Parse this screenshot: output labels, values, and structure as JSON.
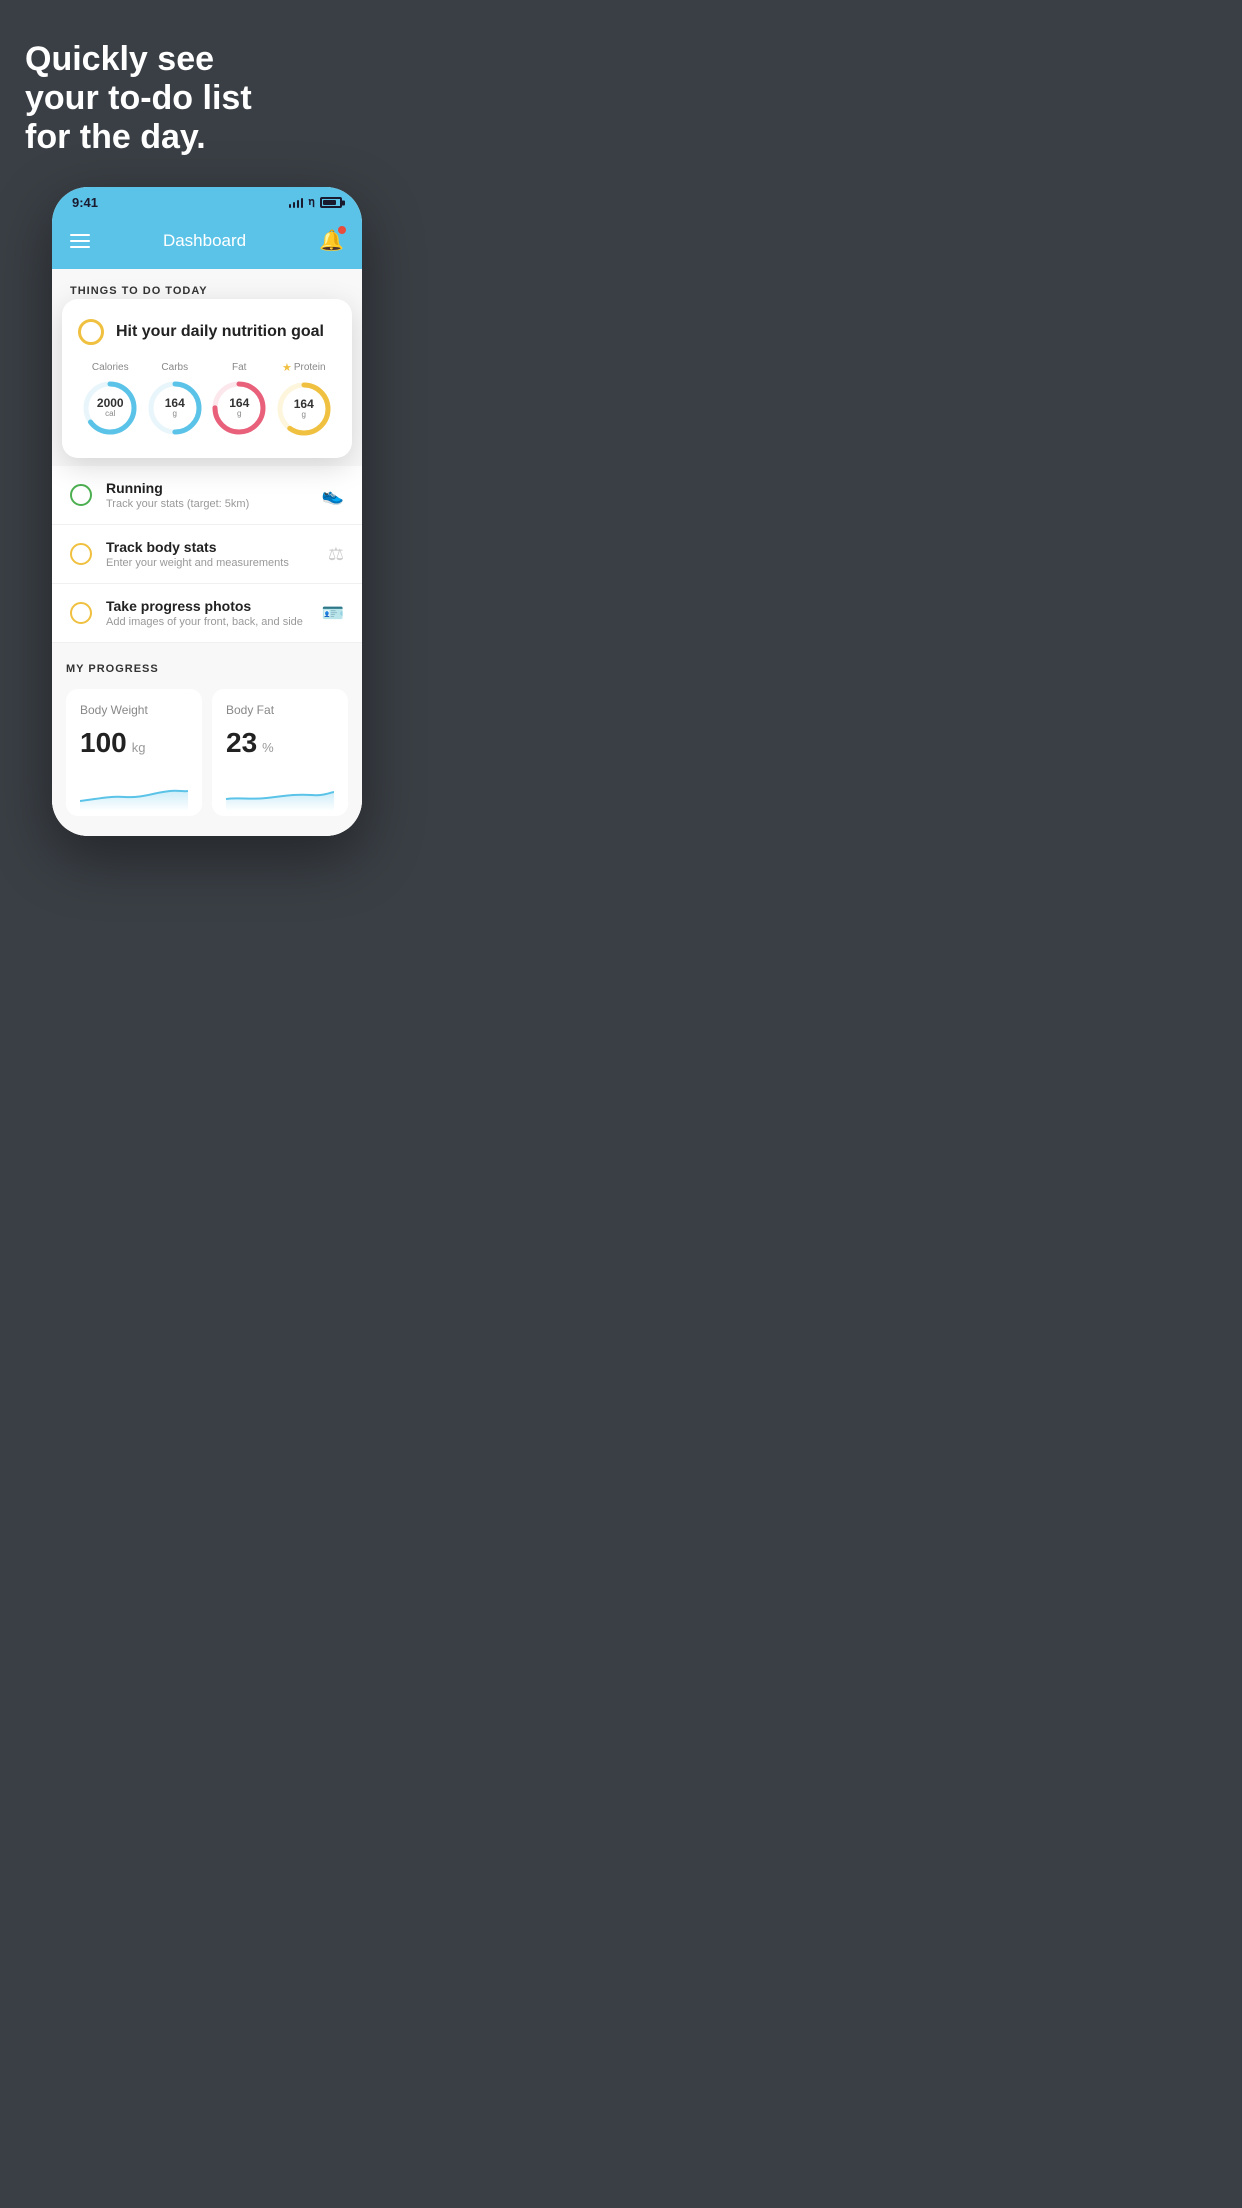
{
  "page": {
    "background_color": "#3a3f45"
  },
  "headline": {
    "line1": "Quickly see",
    "line2": "your to-do list",
    "line3": "for the day."
  },
  "status_bar": {
    "time": "9:41"
  },
  "header": {
    "title": "Dashboard"
  },
  "things_section": {
    "label": "THINGS TO DO TODAY"
  },
  "nutrition_card": {
    "title": "Hit your daily nutrition goal",
    "items": [
      {
        "label": "Calories",
        "value": "2000",
        "unit": "cal",
        "color": "#5bc3e8",
        "pct": 65
      },
      {
        "label": "Carbs",
        "value": "164",
        "unit": "g",
        "color": "#5bc3e8",
        "pct": 50
      },
      {
        "label": "Fat",
        "value": "164",
        "unit": "g",
        "color": "#e8607a",
        "pct": 75
      },
      {
        "label": "Protein",
        "value": "164",
        "unit": "g",
        "color": "#f0c040",
        "pct": 60,
        "starred": true
      }
    ]
  },
  "todo_items": [
    {
      "title": "Running",
      "subtitle": "Track your stats (target: 5km)",
      "circle_color": "green",
      "icon": "👟"
    },
    {
      "title": "Track body stats",
      "subtitle": "Enter your weight and measurements",
      "circle_color": "yellow",
      "icon": "⚖"
    },
    {
      "title": "Take progress photos",
      "subtitle": "Add images of your front, back, and side",
      "circle_color": "yellow",
      "icon": "🪪"
    }
  ],
  "progress_section": {
    "label": "MY PROGRESS",
    "cards": [
      {
        "title": "Body Weight",
        "value": "100",
        "unit": "kg"
      },
      {
        "title": "Body Fat",
        "value": "23",
        "unit": "%"
      }
    ]
  }
}
